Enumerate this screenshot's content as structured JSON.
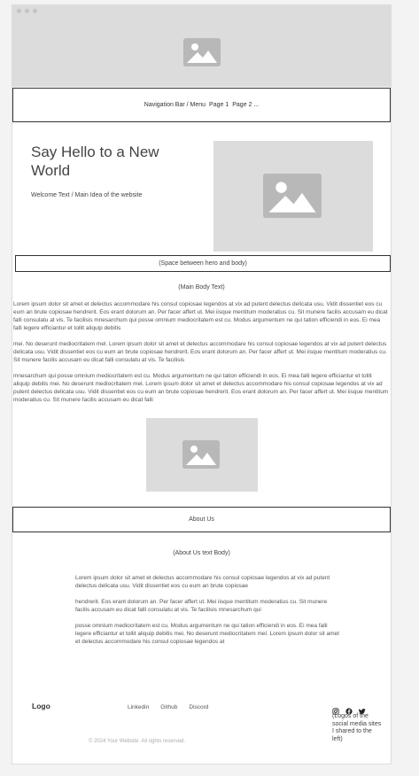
{
  "nav": {
    "label": "Navigation Bar / Menu",
    "pages": [
      "Page 1",
      "Page 2 ..."
    ]
  },
  "hero": {
    "title": "Say Hello to a New World",
    "subtitle": "Welcome Text / Main Idea of the website"
  },
  "spacer_label": "(Space between hero and body)",
  "main_body": {
    "label": "(Main Body Text)",
    "paragraphs": [
      "Lorem ipsum dolor sit amet et delectus accommodare his consul copiosae legendos at vix ad putent delectus delicata usu. Vidit dissentiet eos cu eum an brute copiosae hendrerit. Eos erant dolorum an. Per facer affert ut. Mei iisque mentitum moderatius cu. Sit munere facilis accusam eu dicat falli consulatu at vis. Te facilisis mnesarchum qui posse omnium mediocritatem est cu. Modus argumentum ne qui tation efficiendi in eos. Ei mea falli legere efficiantur et tollit aliquip debitis",
      "mei. No deserunt mediocritatem mel. Lorem ipsum dolor sit amet et delectus accommodare his consul copiosae legendos at vix ad putent delectus delicata usu. Vidit dissentiet eos cu eum an brute copiosae hendrerit. Eos erant dolorum an. Per facer affert ut. Mei iisque mentitum moderatius cu. Sit munere facilis accusam eu dicat falli consulatu at vis. Te facilisis",
      "mnesarchum qui posse omnium mediocritatem est cu. Modus argumentum ne qui tation efficiendi in eos. Ei mea falli legere efficiantur et tollit aliquip debitis mei. No deserunt mediocritatem mel. Lorem ipsum dolor sit amet et delectus accommodare his consul copiosae legendos at vix ad putent delectus delicata usu. Vidit dissentiet eos cu eum an brute copiosae hendrerit. Eos erant dolorum an. Per facer affert ut. Mei iisque mentitum moderatius cu. Sit munere facilis accusam eu dicat falli"
    ]
  },
  "about": {
    "heading": "About Us",
    "label": "(About Us text Body)",
    "paragraphs": [
      "Lorem ipsum dolor sit amet et delectus accommodare his consul copiosae legendos at vix ad putent delectus delicata usu. Vidit dissentiet eos cu eum an brute copiosae",
      "hendrerit. Eos erant dolorum an. Per facer affert ut. Mei iisque mentitum moderatius cu. Sit munere facilis accusam eu dicat falli consulatu at vis. Te facilisis mnesarchum qui",
      "posse omnium mediocritatem est cu. Modus argumentum ne qui tation efficiendi in eos. Ei mea falli legere efficiantur et tollit aliquip debitis mei. No deserunt mediocritatem mel. Lorem ipsum dolor sit amet et delectus accommodare his consul copiosae legendos at"
    ]
  },
  "footer": {
    "logo": "Logo",
    "links": [
      "Linkedin",
      "Github",
      "Discord"
    ],
    "copyright": "© 2024 Your Website. All rights reserved.",
    "social_icons": [
      "instagram-icon",
      "facebook-icon",
      "twitter-icon"
    ],
    "social_note": "(Logos of the social media sites I shared to the left)"
  },
  "colors": {
    "placeholder_bg": "#dcdcdc",
    "placeholder_icon": "#b8b8b8",
    "border": "#333333"
  }
}
